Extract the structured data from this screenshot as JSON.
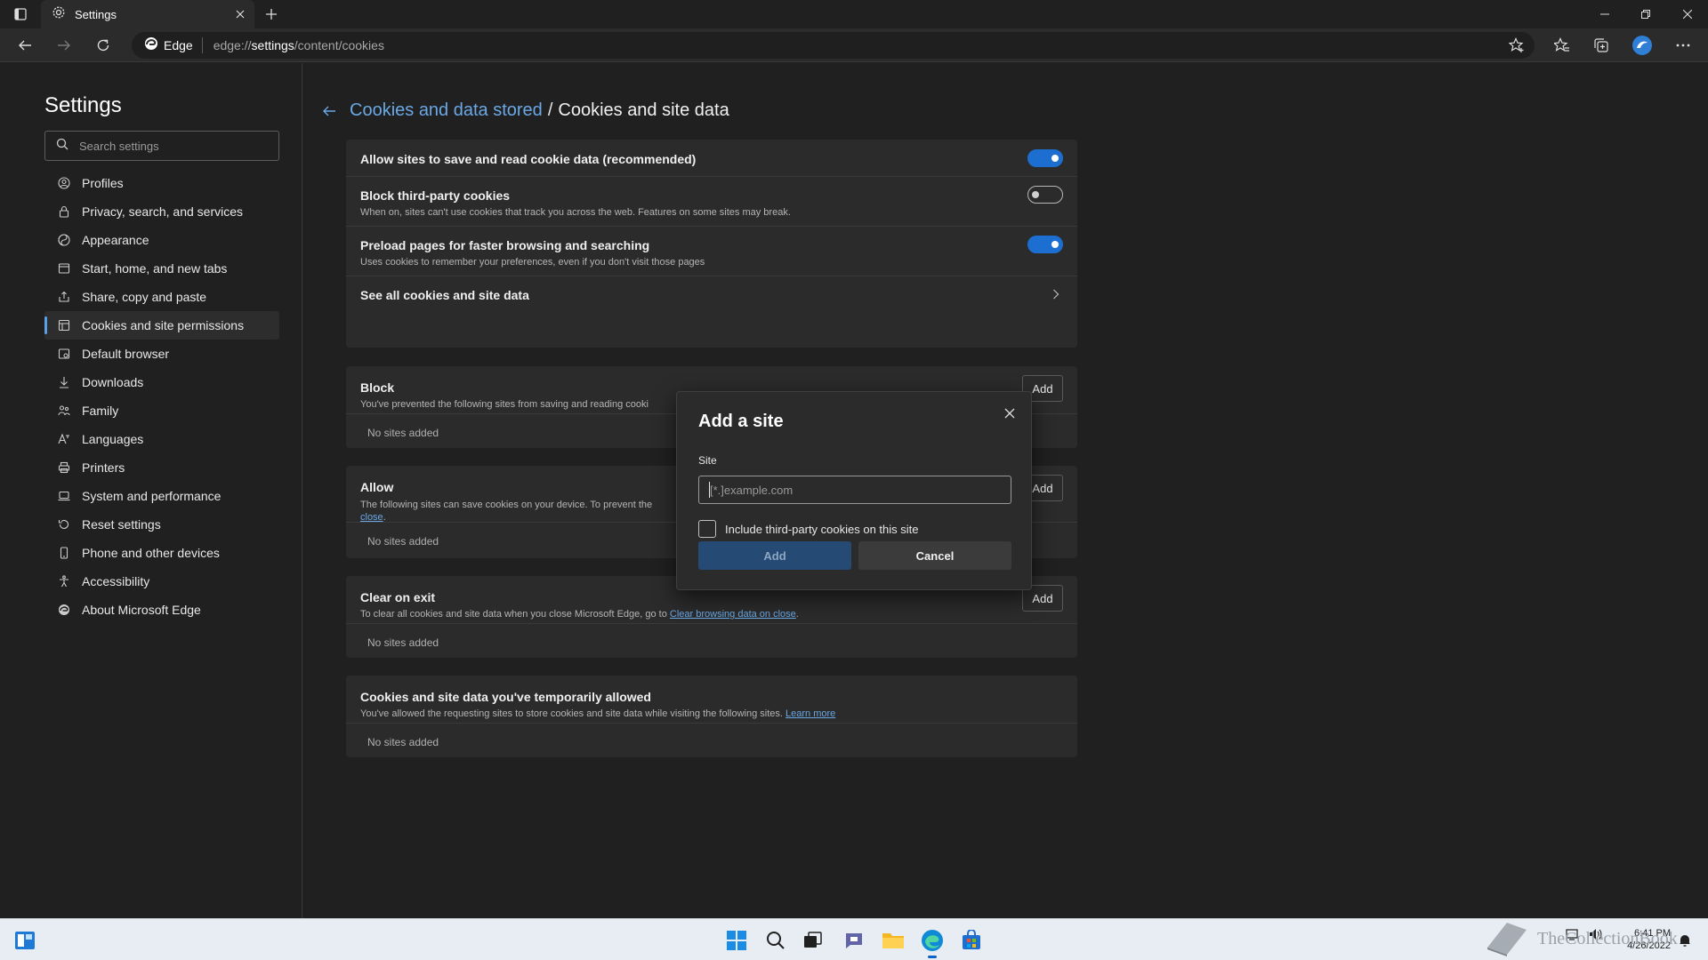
{
  "browser": {
    "tab_title": "Settings",
    "address_prefix": "Edge",
    "address_url_pre": "edge://",
    "address_url_bold": "settings",
    "address_url_post": "/content/cookies"
  },
  "sidebar": {
    "title": "Settings",
    "search_placeholder": "Search settings",
    "items": [
      {
        "label": "Profiles",
        "icon": "profile-icon"
      },
      {
        "label": "Privacy, search, and services",
        "icon": "lock-icon"
      },
      {
        "label": "Appearance",
        "icon": "appearance-icon"
      },
      {
        "label": "Start, home, and new tabs",
        "icon": "home-icon"
      },
      {
        "label": "Share, copy and paste",
        "icon": "share-icon"
      },
      {
        "label": "Cookies and site permissions",
        "icon": "cookie-icon"
      },
      {
        "label": "Default browser",
        "icon": "browser-icon"
      },
      {
        "label": "Downloads",
        "icon": "download-icon"
      },
      {
        "label": "Family",
        "icon": "family-icon"
      },
      {
        "label": "Languages",
        "icon": "language-icon"
      },
      {
        "label": "Printers",
        "icon": "printer-icon"
      },
      {
        "label": "System and performance",
        "icon": "laptop-icon"
      },
      {
        "label": "Reset settings",
        "icon": "reset-icon"
      },
      {
        "label": "Phone and other devices",
        "icon": "phone-icon"
      },
      {
        "label": "Accessibility",
        "icon": "accessibility-icon"
      },
      {
        "label": "About Microsoft Edge",
        "icon": "edge-icon"
      }
    ]
  },
  "breadcrumb": {
    "parent": "Cookies and data stored",
    "separator": "/",
    "current": "Cookies and site data"
  },
  "settings": {
    "allow_title": "Allow sites to save and read cookie data (recommended)",
    "allow_on": true,
    "block3p_title": "Block third-party cookies",
    "block3p_desc": "When on, sites can't use cookies that track you across the web. Features on some sites may break.",
    "block3p_on": false,
    "preload_title": "Preload pages for faster browsing and searching",
    "preload_desc": "Uses cookies to remember your preferences, even if you don't visit those pages",
    "preload_on": true,
    "see_all": "See all cookies and site data"
  },
  "block_section": {
    "title": "Block",
    "desc": "You've prevented the following sites from saving and reading cooki",
    "add": "Add",
    "empty": "No sites added"
  },
  "allow_section": {
    "title": "Allow",
    "desc": "The following sites can save cookies on your device. To prevent the",
    "desc_link": "close",
    "add": "Add",
    "empty": "No sites added"
  },
  "clear_section": {
    "title": "Clear on exit",
    "desc": "To clear all cookies and site data when you close Microsoft Edge, go to ",
    "desc_link": "Clear browsing data on close",
    "add": "Add",
    "empty": "No sites added"
  },
  "temp_section": {
    "title": "Cookies and site data you've temporarily allowed",
    "desc": "You've allowed the requesting sites to store cookies and site data while visiting the following sites. ",
    "desc_link": "Learn more",
    "empty": "No sites added"
  },
  "dialog": {
    "title": "Add a site",
    "site_label": "Site",
    "site_placeholder": "[*.]example.com",
    "checkbox_label": "Include third-party cookies on this site",
    "add": "Add",
    "cancel": "Cancel"
  },
  "taskbar": {
    "time": "6:41 PM",
    "date": "4/26/2022",
    "watermark": "TheCollectionBook"
  },
  "colors": {
    "accent": "#1c6fd1",
    "link": "#6aa8e6"
  }
}
